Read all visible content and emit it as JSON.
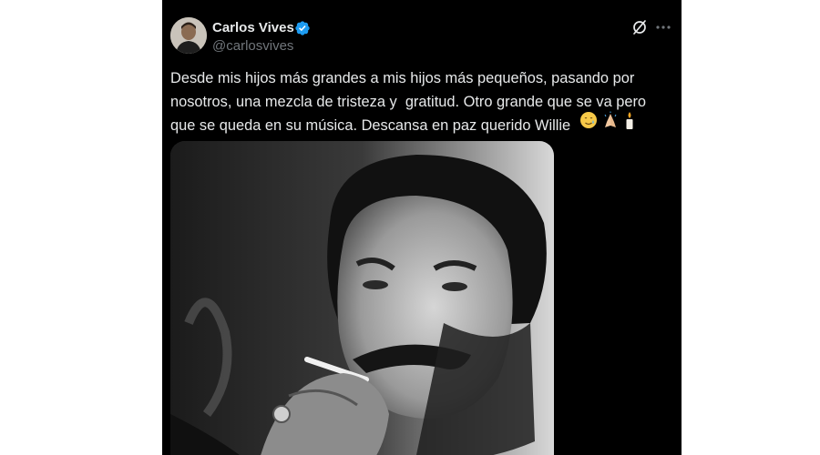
{
  "tweet": {
    "author": {
      "display_name": "Carlos Vives",
      "handle": "@carlosvives",
      "verified": true,
      "verified_color": "#1d9bf0"
    },
    "text": "Desde mis hijos más grandes a mis hijos más pequeños, pasando por nosotros, una mezcla de tristeza y  gratitud. Otro grande que se va pero que se queda en su música. Descansa en paz querido Willie",
    "emojis": [
      "smiling-face-with-tear-emoji",
      "folded-hands-emoji",
      "candle-emoji"
    ],
    "media": {
      "type": "photo",
      "style": "black-and-white portrait"
    }
  },
  "header_actions": [
    "grok-icon",
    "more-icon"
  ],
  "colors": {
    "background": "#000000",
    "text_primary": "#e7e9ea",
    "text_secondary": "#71767b"
  }
}
